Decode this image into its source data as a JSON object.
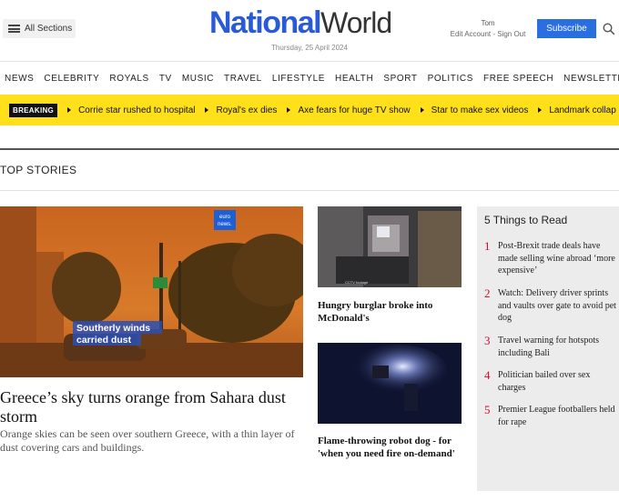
{
  "header": {
    "sections_label": "All Sections",
    "logo_part1": "National",
    "logo_part2": "World",
    "date": "Thursday, 25 April 2024",
    "user_name": "Tom",
    "user_links": "Edit Account - Sign Out",
    "subscribe_label": "Subscribe"
  },
  "nav": {
    "items": [
      "NEWS",
      "CELEBRITY",
      "ROYALS",
      "TV",
      "MUSIC",
      "TRAVEL",
      "LIFESTYLE",
      "HEALTH",
      "SPORT",
      "POLITICS",
      "FREE SPEECH",
      "NEWSLETTERS"
    ]
  },
  "breaking": {
    "tag": "BREAKING",
    "items": [
      "Corrie star rushed to hospital",
      "Royal's ex dies",
      "Axe fears for huge TV show",
      "Star to make sex videos",
      "Landmark collap"
    ]
  },
  "top_stories": {
    "title": "TOP STORIES",
    "lead": {
      "headline": "Greece’s sky turns orange from Sahara dust storm",
      "standfirst": "Orange skies can be seen over southern Greece, with a thin layer of dust covering cars and buildings.",
      "image_caption": "Southerly winds carried dust",
      "image_logo": "euro news."
    },
    "stories": [
      {
        "headline": "Hungry burglar broke into McDonald's"
      },
      {
        "headline": "Flame-throwing robot dog - for 'when you need fire on-demand'"
      }
    ]
  },
  "five_things": {
    "title": "5 Things to Read",
    "items": [
      {
        "num": "1",
        "text": "Post-Brexit trade deals have made selling wine abroad ‘more expensive’"
      },
      {
        "num": "2",
        "text": "Watch: Delivery driver sprints and vaults over gate to avoid pet dog"
      },
      {
        "num": "3",
        "text": "Travel warning for hotspots including Bali"
      },
      {
        "num": "4",
        "text": "Politician bailed over sex charges"
      },
      {
        "num": "5",
        "text": "Premier League footballers held for rape"
      }
    ]
  },
  "colors": {
    "brand_blue": "#2a5bd7",
    "subscribe_blue": "#2a6fe0",
    "breaking_yellow": "#ffe01b",
    "panel_number_red": "#c8102e"
  }
}
